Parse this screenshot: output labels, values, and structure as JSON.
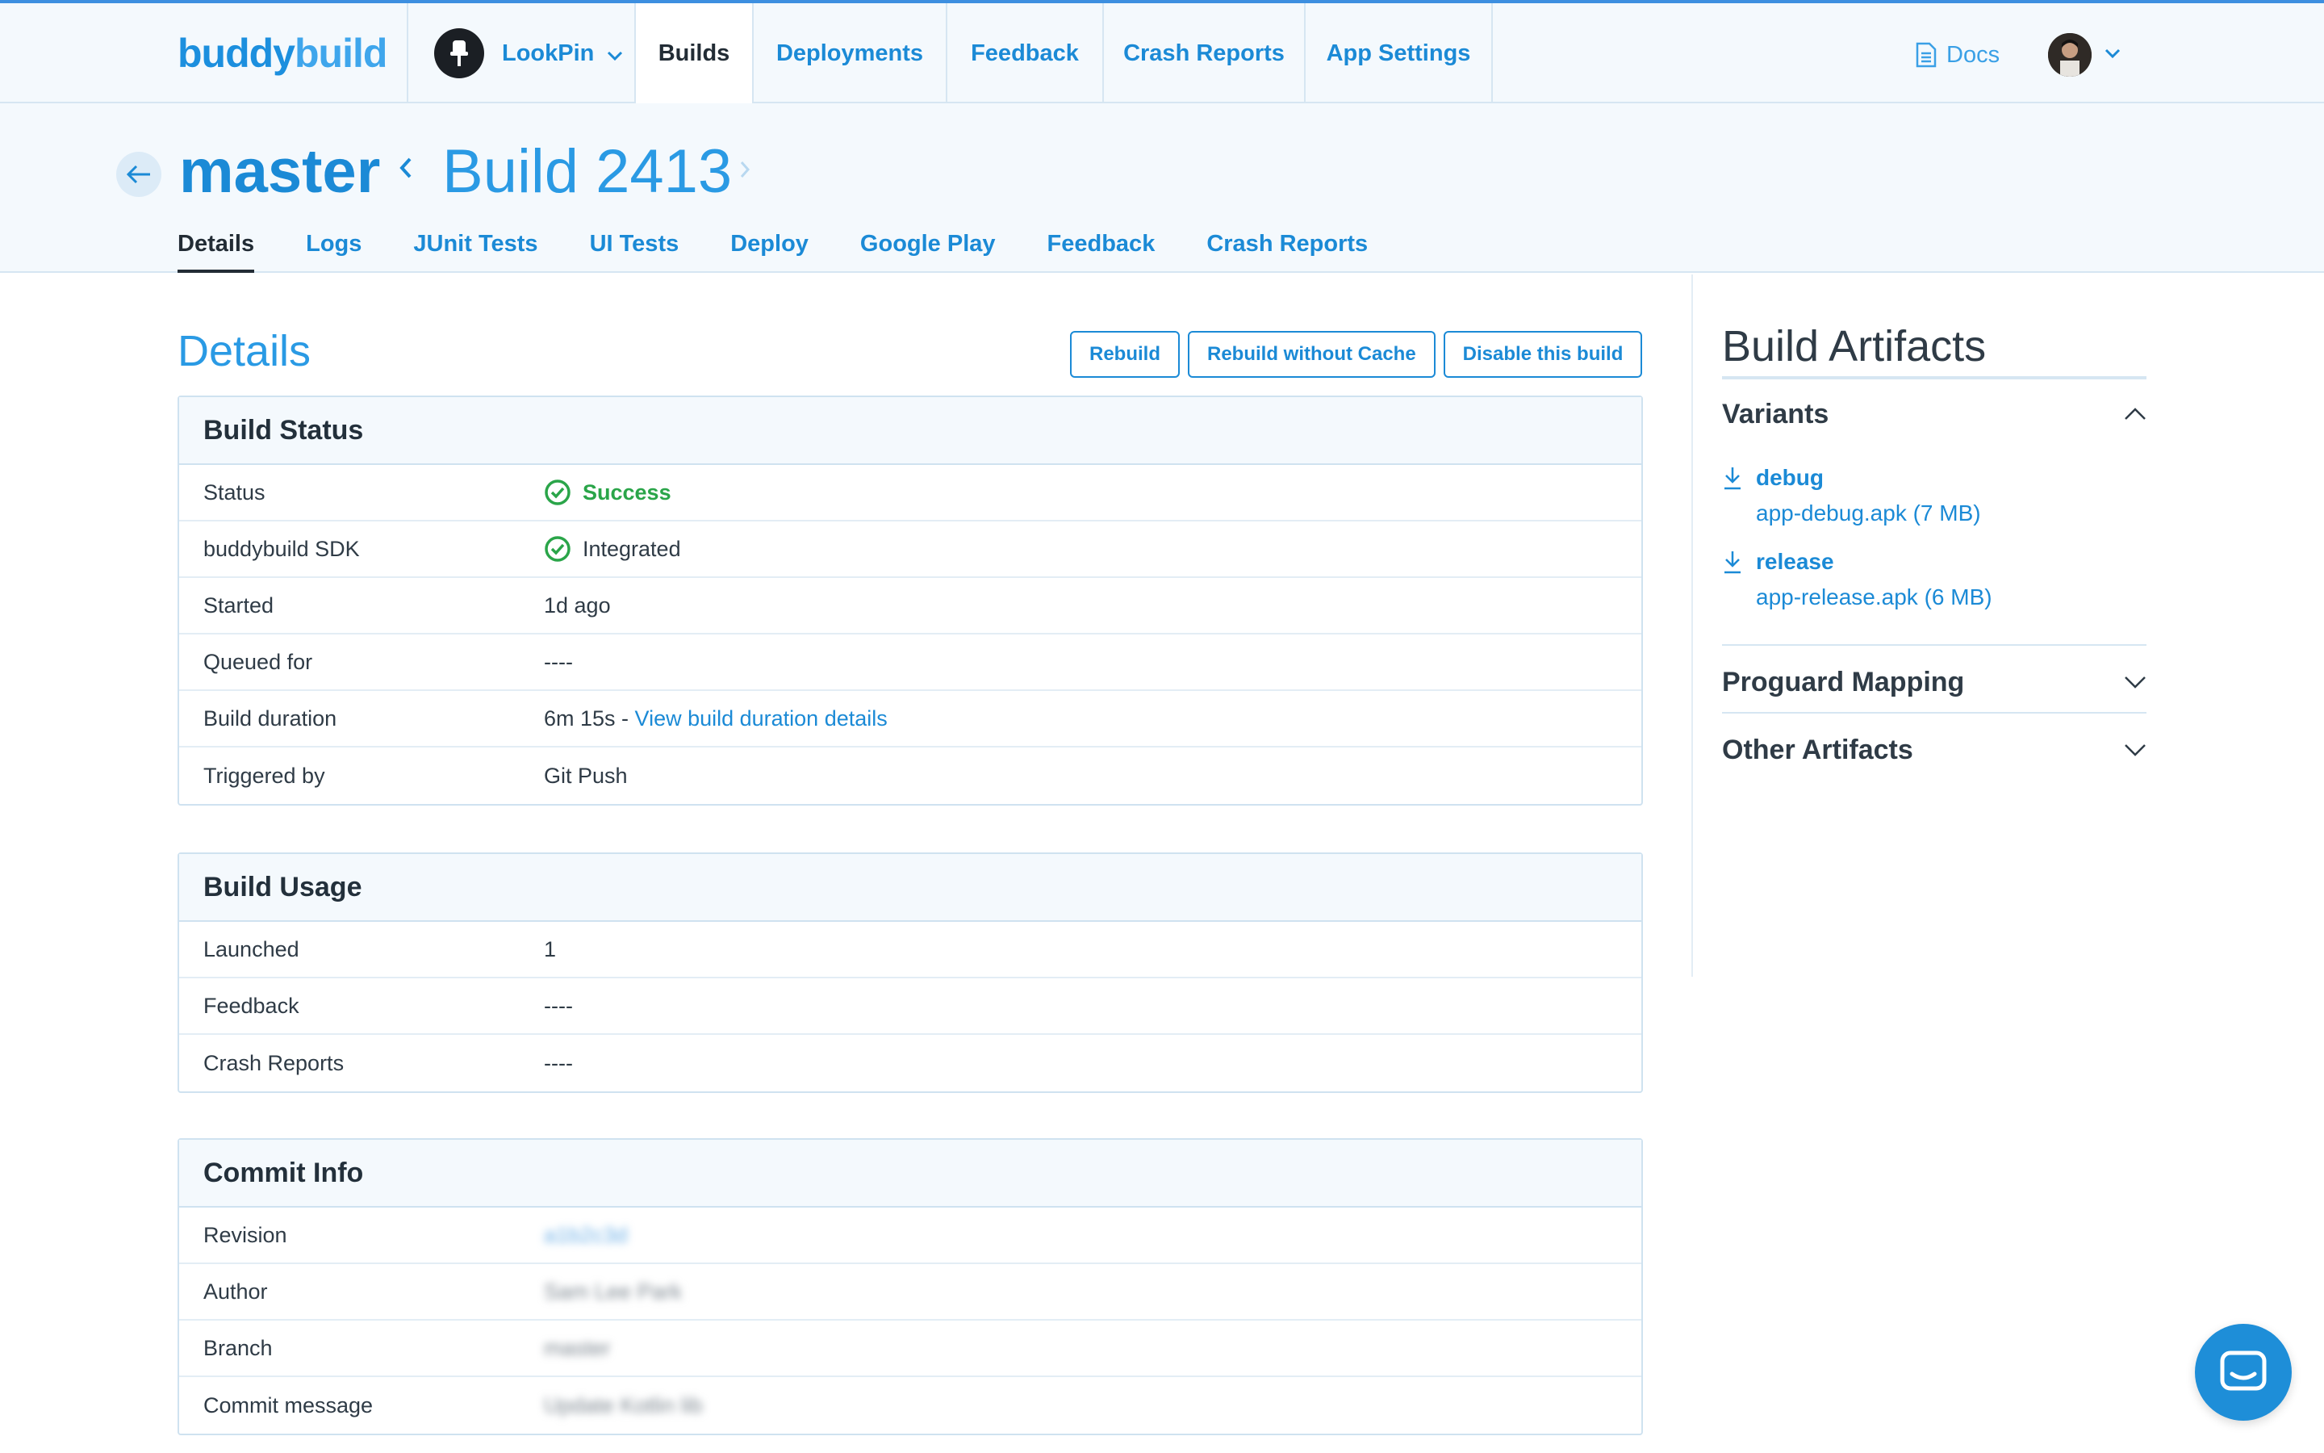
{
  "brand": {
    "part1": "buddy",
    "part2": "build"
  },
  "app": {
    "name": "LookPin"
  },
  "nav": {
    "builds": "Builds",
    "deployments": "Deployments",
    "feedback": "Feedback",
    "crash_reports": "Crash Reports",
    "app_settings": "App Settings",
    "docs": "Docs"
  },
  "header": {
    "branch": "master",
    "build": "Build 2413"
  },
  "tabs": [
    "Details",
    "Logs",
    "JUnit Tests",
    "UI Tests",
    "Deploy",
    "Google Play",
    "Feedback",
    "Crash Reports"
  ],
  "main": {
    "title": "Details",
    "actions": {
      "rebuild": "Rebuild",
      "rebuild_no_cache": "Rebuild without Cache",
      "disable": "Disable this build"
    }
  },
  "build_status": {
    "title": "Build Status",
    "rows": {
      "status": {
        "label": "Status",
        "value": "Success"
      },
      "sdk": {
        "label": "buddybuild SDK",
        "value": "Integrated"
      },
      "started": {
        "label": "Started",
        "value": "1d ago"
      },
      "queued": {
        "label": "Queued for",
        "value": "----"
      },
      "duration": {
        "label": "Build duration",
        "value": "6m 15s - ",
        "link": "View build duration details"
      },
      "trigger": {
        "label": "Triggered by",
        "value": "Git Push"
      }
    }
  },
  "build_usage": {
    "title": "Build Usage",
    "rows": {
      "launched": {
        "label": "Launched",
        "value": "1"
      },
      "feedback": {
        "label": "Feedback",
        "value": "----"
      },
      "crashes": {
        "label": "Crash Reports",
        "value": "----"
      }
    }
  },
  "commit_info": {
    "title": "Commit Info",
    "rows": {
      "revision": {
        "label": "Revision",
        "value": "a1b2c3d"
      },
      "author": {
        "label": "Author",
        "value": "Sam Lee Park"
      },
      "branch": {
        "label": "Branch",
        "value": "master"
      },
      "message": {
        "label": "Commit message",
        "value": "Update Kotlin lib"
      }
    }
  },
  "sidebar": {
    "title": "Build Artifacts",
    "variants": {
      "title": "Variants",
      "items": [
        {
          "name": "debug",
          "file": "app-debug.apk (7 MB)"
        },
        {
          "name": "release",
          "file": "app-release.apk (6 MB)"
        }
      ]
    },
    "proguard": "Proguard Mapping",
    "other": "Other Artifacts"
  },
  "colors": {
    "accent": "#1b8ad6",
    "success": "#2aa549",
    "header_bg": "#f4f9fd"
  },
  "icons": [
    "pin-icon",
    "chevron-down-icon",
    "document-icon",
    "arrow-left-icon",
    "chevron-left-icon",
    "chevron-right-icon",
    "check-circle-icon",
    "download-icon",
    "chevron-up-icon",
    "chat-icon"
  ]
}
